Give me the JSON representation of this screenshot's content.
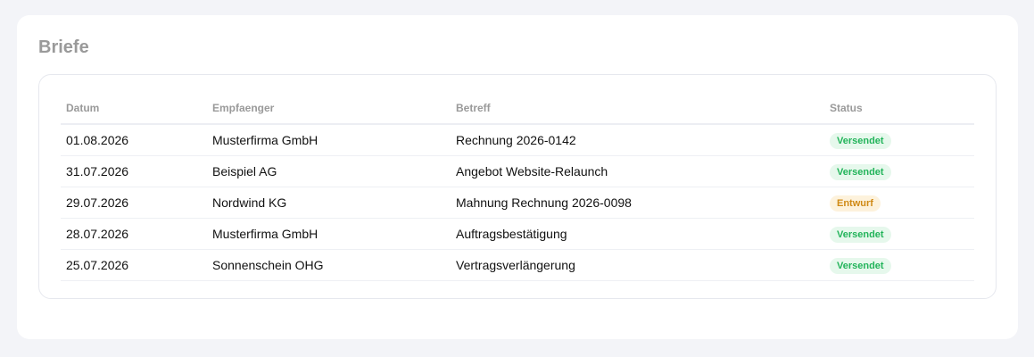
{
  "page": {
    "title": "Briefe"
  },
  "table": {
    "headers": {
      "date": "Datum",
      "recipient": "Empfaenger",
      "subject": "Betreff",
      "status": "Status"
    },
    "rows": [
      {
        "date": "01.08.2026",
        "recipient": "Musterfirma GmbH",
        "subject": "Rechnung 2026-0142",
        "status": "Versendet",
        "status_kind": "sent"
      },
      {
        "date": "31.07.2026",
        "recipient": "Beispiel AG",
        "subject": "Angebot Website-Relaunch",
        "status": "Versendet",
        "status_kind": "sent"
      },
      {
        "date": "29.07.2026",
        "recipient": "Nordwind KG",
        "subject": "Mahnung Rechnung 2026-0098",
        "status": "Entwurf",
        "status_kind": "draft"
      },
      {
        "date": "28.07.2026",
        "recipient": "Musterfirma GmbH",
        "subject": "Auftragsbestätigung",
        "status": "Versendet",
        "status_kind": "sent"
      },
      {
        "date": "25.07.2026",
        "recipient": "Sonnenschein OHG",
        "subject": "Vertragsverlängerung",
        "status": "Versendet",
        "status_kind": "sent"
      }
    ]
  },
  "colors": {
    "page_background": "#f3f4f8",
    "status_sent": "#22b45a",
    "status_draft": "#d08a15"
  }
}
